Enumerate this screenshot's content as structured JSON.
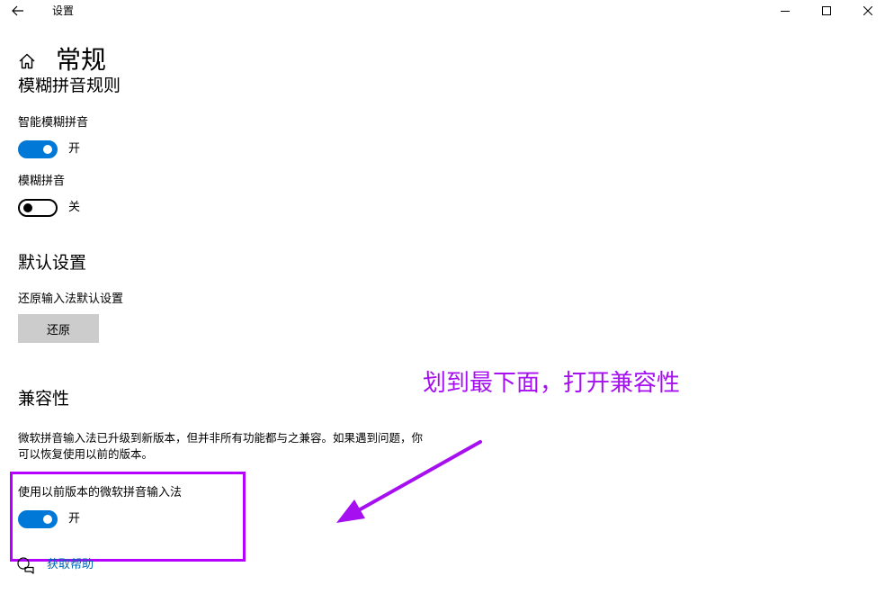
{
  "window": {
    "title": "设置",
    "back_icon": "arrow-left-icon",
    "minimize_icon": "minimize-icon",
    "maximize_icon": "maximize-icon",
    "close_icon": "close-icon"
  },
  "header": {
    "home_icon": "home-icon",
    "title": "常规"
  },
  "fuzzy": {
    "section_title": "模糊拼音规则",
    "smart": {
      "label": "智能模糊拼音",
      "state": "开",
      "on": true
    },
    "fuzzy_pinyin": {
      "label": "模糊拼音",
      "state": "关",
      "on": false
    }
  },
  "defaults": {
    "section_title": "默认设置",
    "restore_label": "还原输入法默认设置",
    "restore_button": "还原"
  },
  "compat": {
    "section_title": "兼容性",
    "description": "微软拼音输入法已升级到新版本，但并非所有功能都与之兼容。如果遇到问题，你可以恢复使用以前的版本。",
    "legacy": {
      "label": "使用以前版本的微软拼音输入法",
      "state": "开",
      "on": true
    }
  },
  "help": {
    "icon": "help-chat-icon",
    "label": "获取帮助"
  },
  "annotation": {
    "text": "划到最下面，打开兼容性",
    "color": "#a610f0",
    "box_color": "#b400ff"
  },
  "colors": {
    "accent": "#0078d7",
    "button_bg": "#cccccc",
    "link": "#0063b1"
  }
}
